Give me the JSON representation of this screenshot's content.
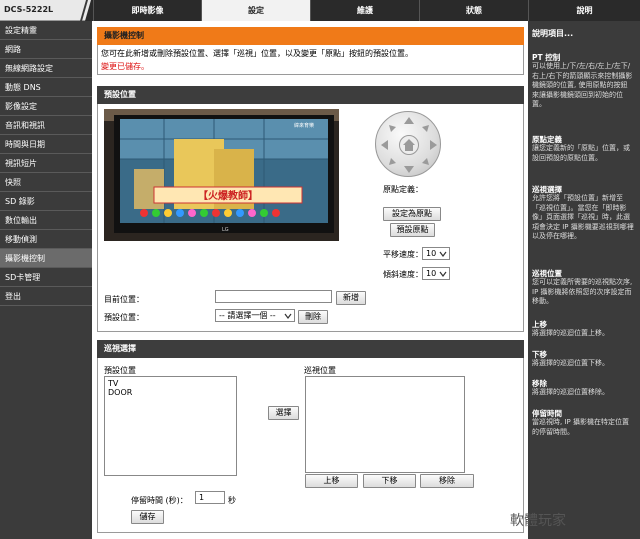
{
  "brand": "DCS-5222L",
  "tabs": [
    "即時影像",
    "設定",
    "維護",
    "狀態",
    "說明"
  ],
  "sidebar": [
    "設定精靈",
    "網路",
    "無線網路設定",
    "動態 DNS",
    "影像設定",
    "音訊和視訊",
    "時間與日期",
    "視訊短片",
    "快照",
    "SD 錄影",
    "數位輸出",
    "移動偵測",
    "攝影機控制",
    "SD卡管理",
    "登出"
  ],
  "intro": {
    "title": "攝影機控制",
    "text": "您可在此新增或刪除預設位置、選擇「巡視」位置，以及變更「原點」按鈕的預設位置。",
    "saved": "變更已儲存。"
  },
  "preset": {
    "title": "預設位置",
    "origin_label": "原點定義：",
    "set_origin_btn": "設定為原點",
    "default_origin_btn": "預設原點",
    "pan_speed_label": "平移速度：",
    "pan_speed": "10",
    "tilt_speed_label": "傾斜速度：",
    "tilt_speed": "10",
    "current_label": "目前位置：",
    "current_value": "",
    "add_btn": "新增",
    "preset_label": "預設位置：",
    "preset_select": "-- 請選擇一個 --",
    "delete_btn": "刪除"
  },
  "video": {
    "banner": "【火爆教師】",
    "tv_brand": "LG",
    "logo": "緯來育樂"
  },
  "patrol": {
    "title": "巡視選擇",
    "preset_list_label": "預設位置",
    "preset_items": [
      "TV",
      "DOOR"
    ],
    "select_btn": "選擇",
    "patrol_list_label": "巡視位置",
    "up_btn": "上移",
    "down_btn": "下移",
    "remove_btn": "移除",
    "dwell_label": "停留時間 (秒)：",
    "dwell_value": "1",
    "dwell_unit": "秒",
    "save_btn": "儲存"
  },
  "help": {
    "title": "說明項目...",
    "sections": [
      {
        "h": "PT 控制",
        "p": "可以使用上/下/左/右/左上/左下/右上/右下的箭頭顯示來控制攝影機鏡頭的位置, 使用原點的按鈕來讓攝影機鏡頭回到初始的位置。"
      },
      {
        "h": "原點定義",
        "p": "讓您定義新的「原點」位置，或設回預設的原點位置。"
      },
      {
        "h": "巡視選擇",
        "p": "允許您將「預設位置」新增至「巡視位置」。當您在「即時影像」頁面選擇「巡視」時，此選項會決定 IP 攝影機要巡視到哪裡以及停在哪裡。"
      },
      {
        "h": "巡視位置",
        "p": "您可以定義所需要的巡視點次序, IP 攝影機將依照您的次序設定而移動。"
      },
      {
        "h": "上移",
        "p": "將選擇的巡迴位置上移。"
      },
      {
        "h": "下移",
        "p": "將選擇的巡迴位置下移。"
      },
      {
        "h": "移除",
        "p": "將選擇的巡迴位置移除。"
      },
      {
        "h": "停留時間",
        "p": "當巡視時, IP 攝影機在特定位置的停留時間。"
      }
    ]
  },
  "watermark": "軟體玩家"
}
